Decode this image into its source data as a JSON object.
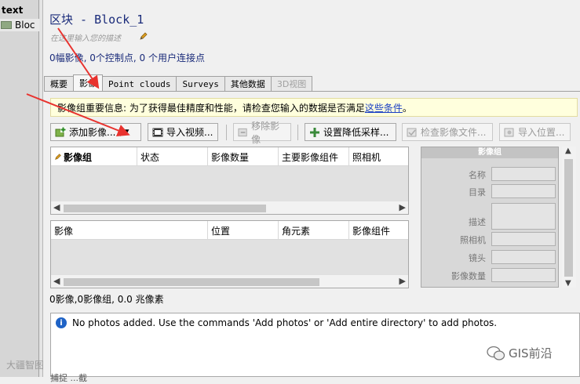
{
  "left_panel": {
    "header": "text",
    "item": "Bloc"
  },
  "block": {
    "title": "区块 - Block_1",
    "description_placeholder": "在这里输入您的描述",
    "summary": "0幅影像, 0个控制点, 0 个用户连接点"
  },
  "tabs": [
    {
      "label": "概要"
    },
    {
      "label": "影像"
    },
    {
      "label": "Point clouds"
    },
    {
      "label": "Surveys"
    },
    {
      "label": "其他数据"
    },
    {
      "label": "3D视图"
    }
  ],
  "infobar": {
    "prefix": "影像组重要信息: 为了获得最佳精度和性能，请检查您输入的数据是否满足",
    "link": "这些条件",
    "suffix": "。"
  },
  "toolbar": {
    "add_photos": "添加影像...",
    "import_video": "导入视频...",
    "remove_photos": "移除影像",
    "set_downsampling": "设置降低采样...",
    "check_image_files": "检查影像文件...",
    "import_positions": "导入位置..."
  },
  "photogroup_table": {
    "columns": [
      "影像组",
      "状态",
      "影像数量",
      "主要影像组件",
      "照相机"
    ]
  },
  "photo_table": {
    "columns": [
      "影像",
      "位置",
      "角元素",
      "影像组件"
    ]
  },
  "props_panel": {
    "title": "影像组",
    "fields": [
      "名称",
      "目录",
      "描述",
      "照相机",
      "镜头",
      "影像数量"
    ]
  },
  "stats": "0影像,0影像组, 0.0 兆像素",
  "message": "No photos added. Use the commands 'Add photos' or 'Add entire directory' to add photos.",
  "bottom_cut": "捕捉 ...截",
  "watermark_right": "GIS前沿",
  "watermark_left": "大疆智图",
  "colors": {
    "title": "#1a2b7a",
    "link": "#1a3fc4",
    "infobar_bg": "#ffffdd",
    "arrow": "#e8322e",
    "info_icon": "#1f63c6"
  }
}
